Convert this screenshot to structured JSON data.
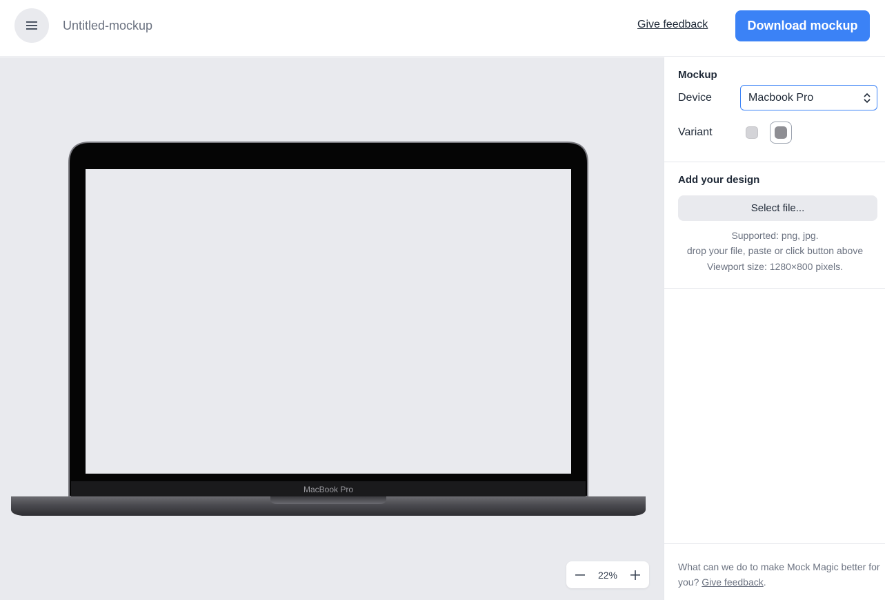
{
  "header": {
    "title": "Untitled-mockup",
    "feedback_label": "Give feedback",
    "download_label": "Download mockup"
  },
  "canvas": {
    "device_logo_text": "MacBook Pro",
    "zoom_value": "22%"
  },
  "sidebar": {
    "mockup": {
      "title": "Mockup",
      "device_label": "Device",
      "device_value": "Macbook Pro",
      "variant_label": "Variant",
      "variants": [
        {
          "color": "#d4d4d8",
          "selected": false
        },
        {
          "color": "#8e8e93",
          "selected": true
        }
      ]
    },
    "design": {
      "title": "Add your design",
      "select_file_label": "Select file...",
      "supported": "Supported: png, jpg.",
      "hint": "drop your file, paste or click button above",
      "viewport": "Viewport size: 1280×800 pixels."
    },
    "footer": {
      "text": "What can we do to make Mock Magic better for you?",
      "link": "Give feedback",
      "suffix": "."
    }
  },
  "colors": {
    "accent": "#3b82f6",
    "canvas_bg": "#e9eaee"
  }
}
